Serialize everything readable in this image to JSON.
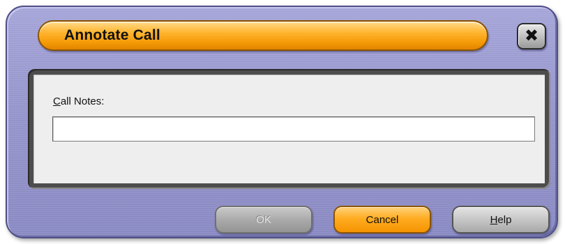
{
  "dialog": {
    "title": "Annotate Call",
    "close_icon": "close-icon",
    "colors": {
      "frame": "#9797cf",
      "title_bar": "#ffb42e",
      "accent_button": "#ffac22"
    }
  },
  "form": {
    "call_notes_label": {
      "mnemonic": "C",
      "rest": "all Notes:"
    },
    "call_notes_value": ""
  },
  "buttons": {
    "ok": {
      "label": "OK",
      "enabled": false
    },
    "cancel": {
      "label": "Cancel",
      "enabled": true
    },
    "help": {
      "mnemonic": "H",
      "rest": "elp",
      "enabled": true
    }
  }
}
